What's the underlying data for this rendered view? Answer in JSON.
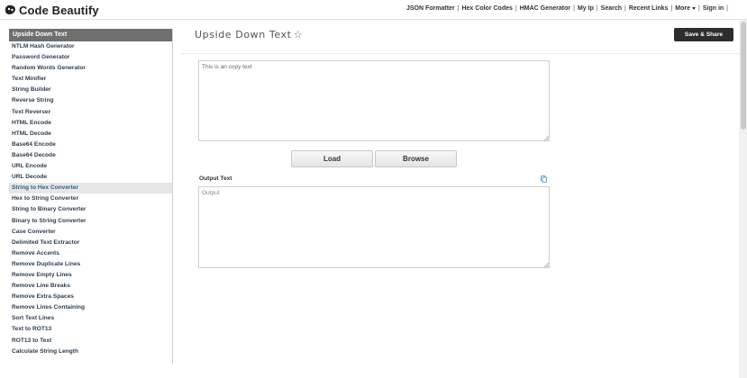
{
  "header": {
    "logo_text": "Code Beautify",
    "nav": [
      {
        "label": "JSON Formatter"
      },
      {
        "label": "Hex Color Codes"
      },
      {
        "label": "HMAC Generator"
      },
      {
        "label": "My Ip"
      },
      {
        "label": "Search"
      },
      {
        "label": "Recent Links"
      },
      {
        "label": "More"
      },
      {
        "label": "Sign in"
      }
    ]
  },
  "sidebar": {
    "heading": "Upside Down Text",
    "items": [
      "NTLM Hash Generator",
      "Password Generator",
      "Random Words Generator",
      "Text Minifier",
      "String Builder",
      "Reverse String",
      "Text Reverser",
      "HTML Encode",
      "HTML Decode",
      "Base64 Encode",
      "Base64 Decode",
      "URL Encode",
      "URL Decode",
      "String to Hex Converter",
      "Hex to String Converter",
      "String to Binary Converter",
      "Binary to String Converter",
      "Case Converter",
      "Delimited Text Extractor",
      "Remove Accents",
      "Remove Duplicate Lines",
      "Remove Empty Lines",
      "Remove Line Breaks",
      "Remove Extra Spaces",
      "Remove Lines Containing",
      "Sort Text Lines",
      "Text to ROT13",
      "ROT13 to Text",
      "Calculate String Length"
    ],
    "active_item": "String to Hex Converter"
  },
  "main": {
    "title": "Upside Down Text",
    "star": "☆",
    "save_label": "Save & Share",
    "input": {
      "value": "This is an copy text",
      "placeholder": ""
    },
    "load_label": "Load",
    "browse_label": "Browse",
    "output_label": "Output Text",
    "output": {
      "value": "",
      "placeholder": "Output"
    }
  },
  "colors": {
    "sidebar_heading_bg": "#6f6f6f",
    "save_button_bg": "#2d2d2d",
    "active_item_bg": "#e6e6e6",
    "link_text": "#2f3e4e"
  },
  "icons": {
    "logo": "code-beautify-logo-icon",
    "favorite": "star-outline-icon",
    "copy": "copy-icon",
    "dropdown": "caret-down-icon",
    "resize": "resize-grip-icon"
  }
}
